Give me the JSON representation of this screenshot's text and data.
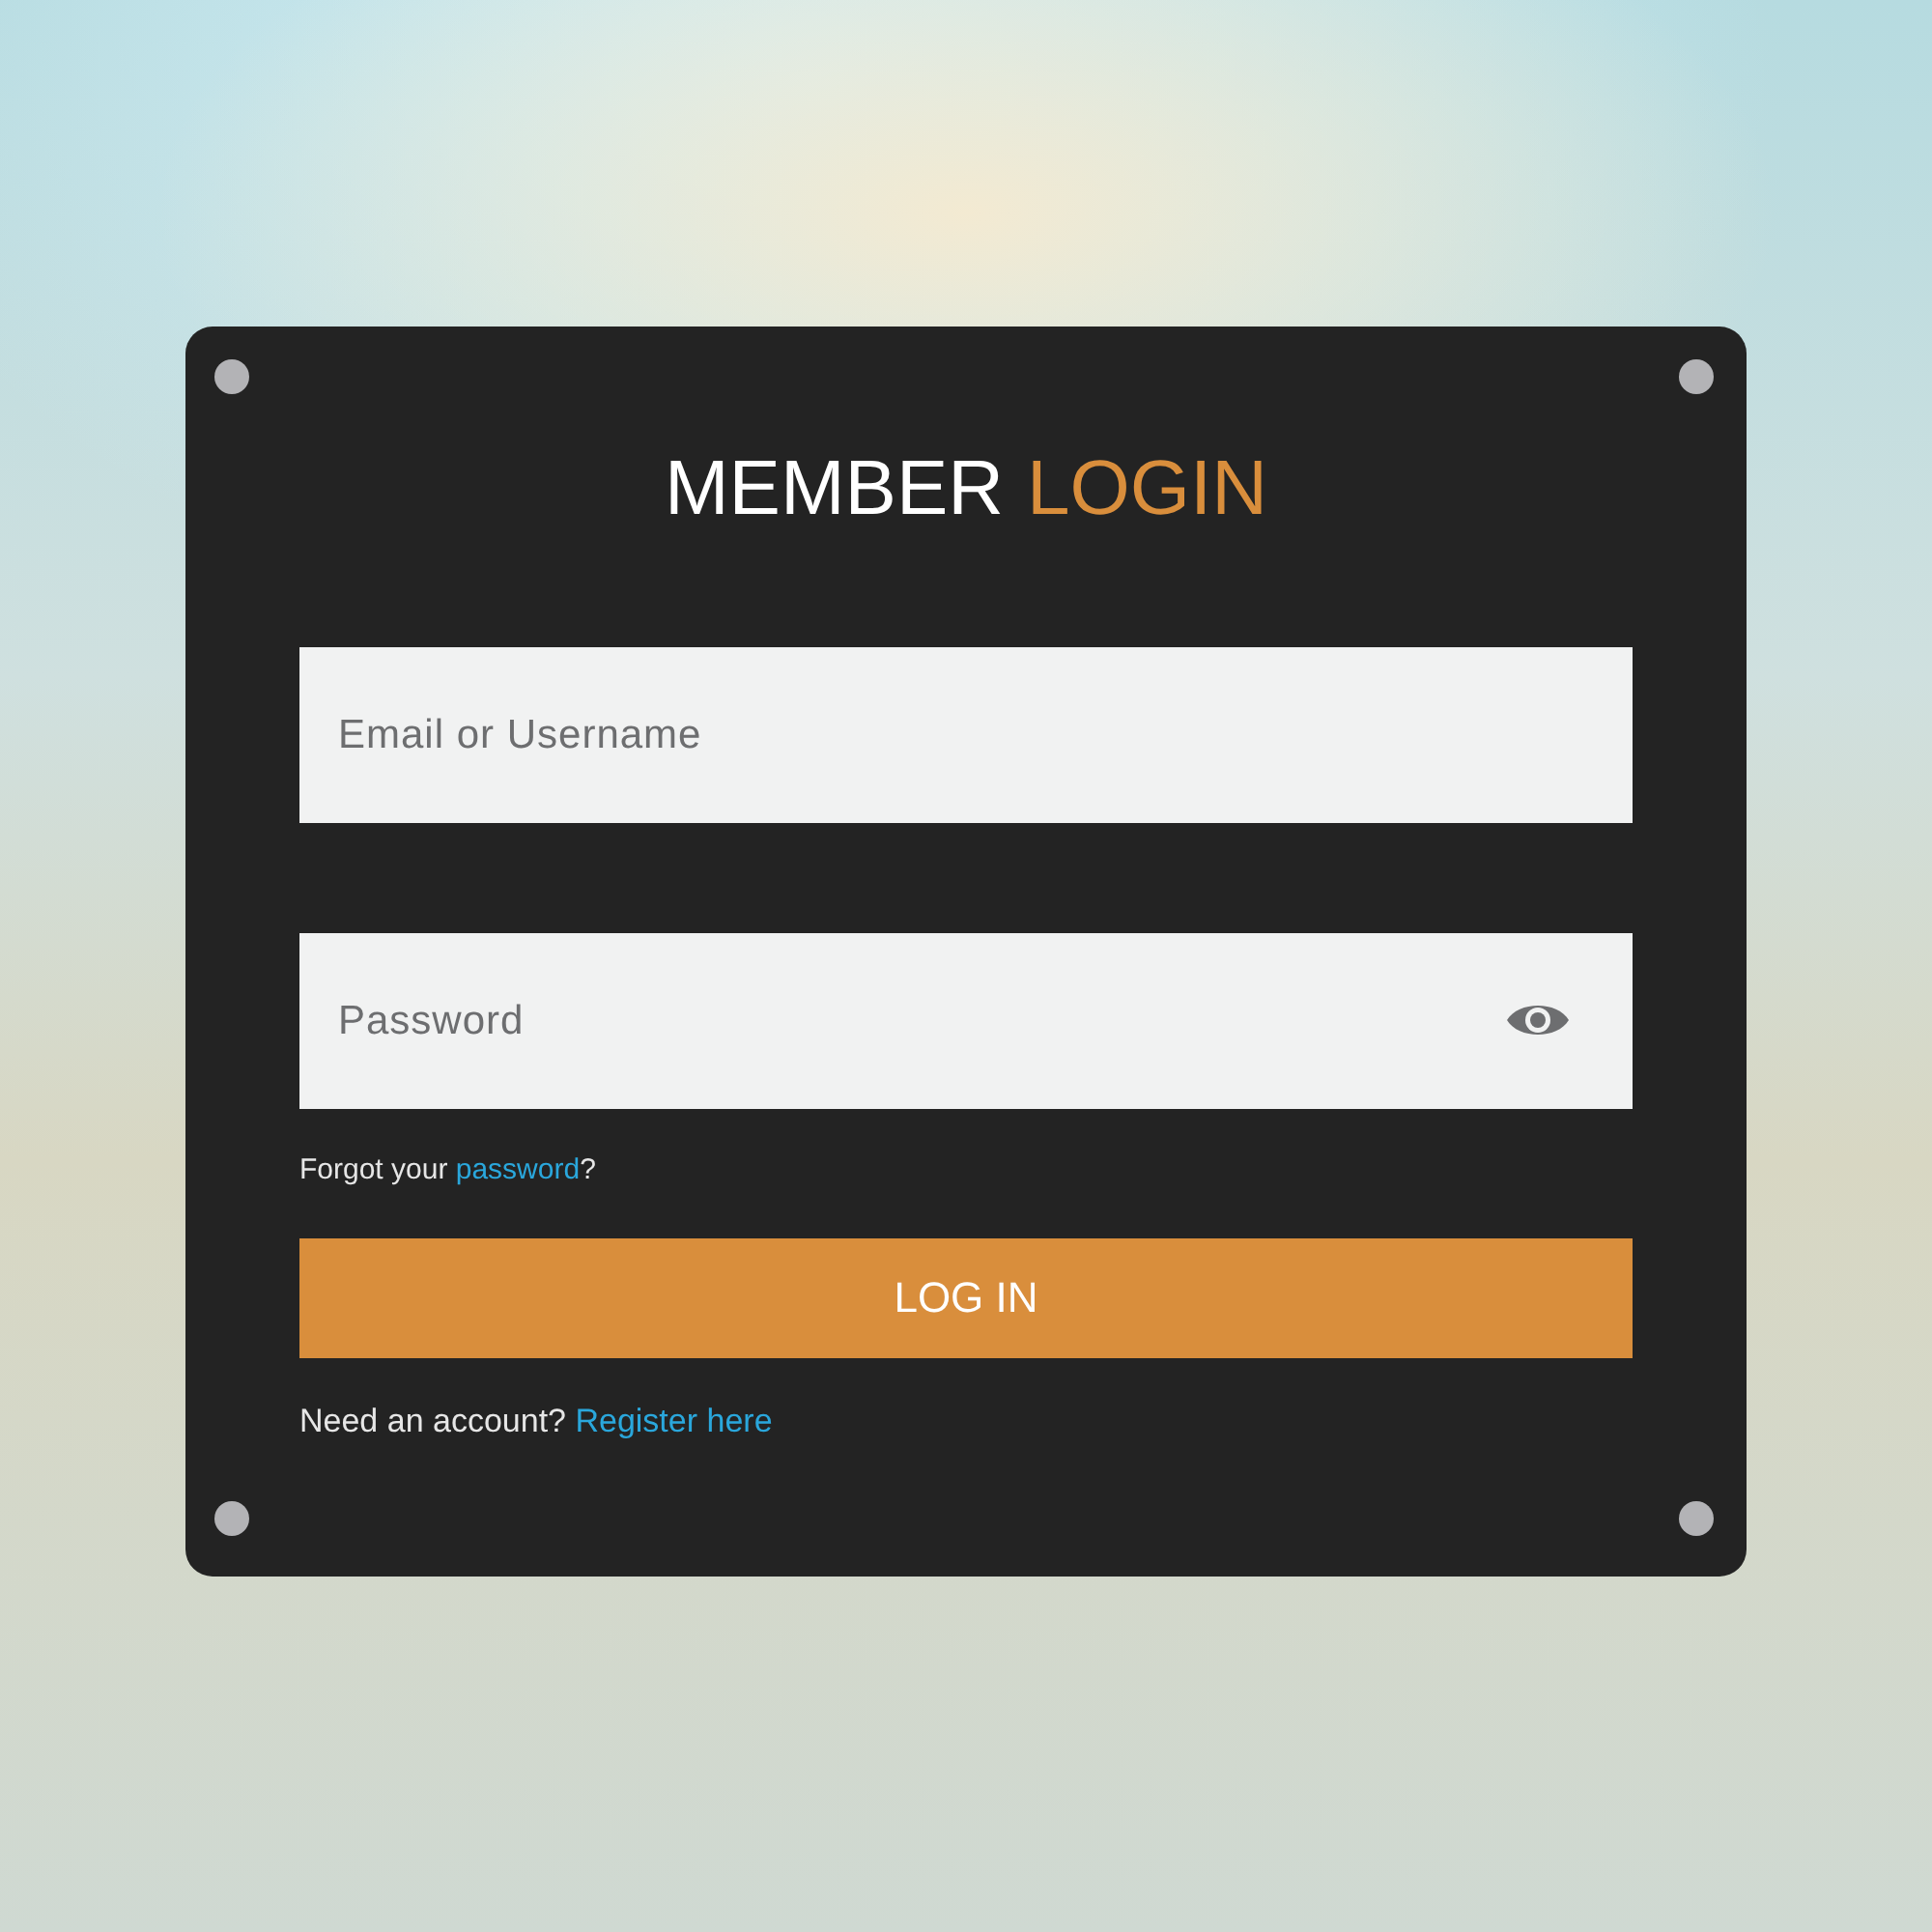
{
  "title": {
    "text": "MEMBER",
    "highlight": "LOGIN"
  },
  "fields": [
    {
      "kind": "text",
      "placeholder": "Email or Username"
    },
    {
      "kind": "password",
      "placeholder": "Password"
    }
  ],
  "forgot": {
    "before": "Forgot your ",
    "link": "password",
    "after": "?"
  },
  "button": "LOG IN",
  "register": {
    "before": "Need an account? ",
    "link": "Register here"
  }
}
